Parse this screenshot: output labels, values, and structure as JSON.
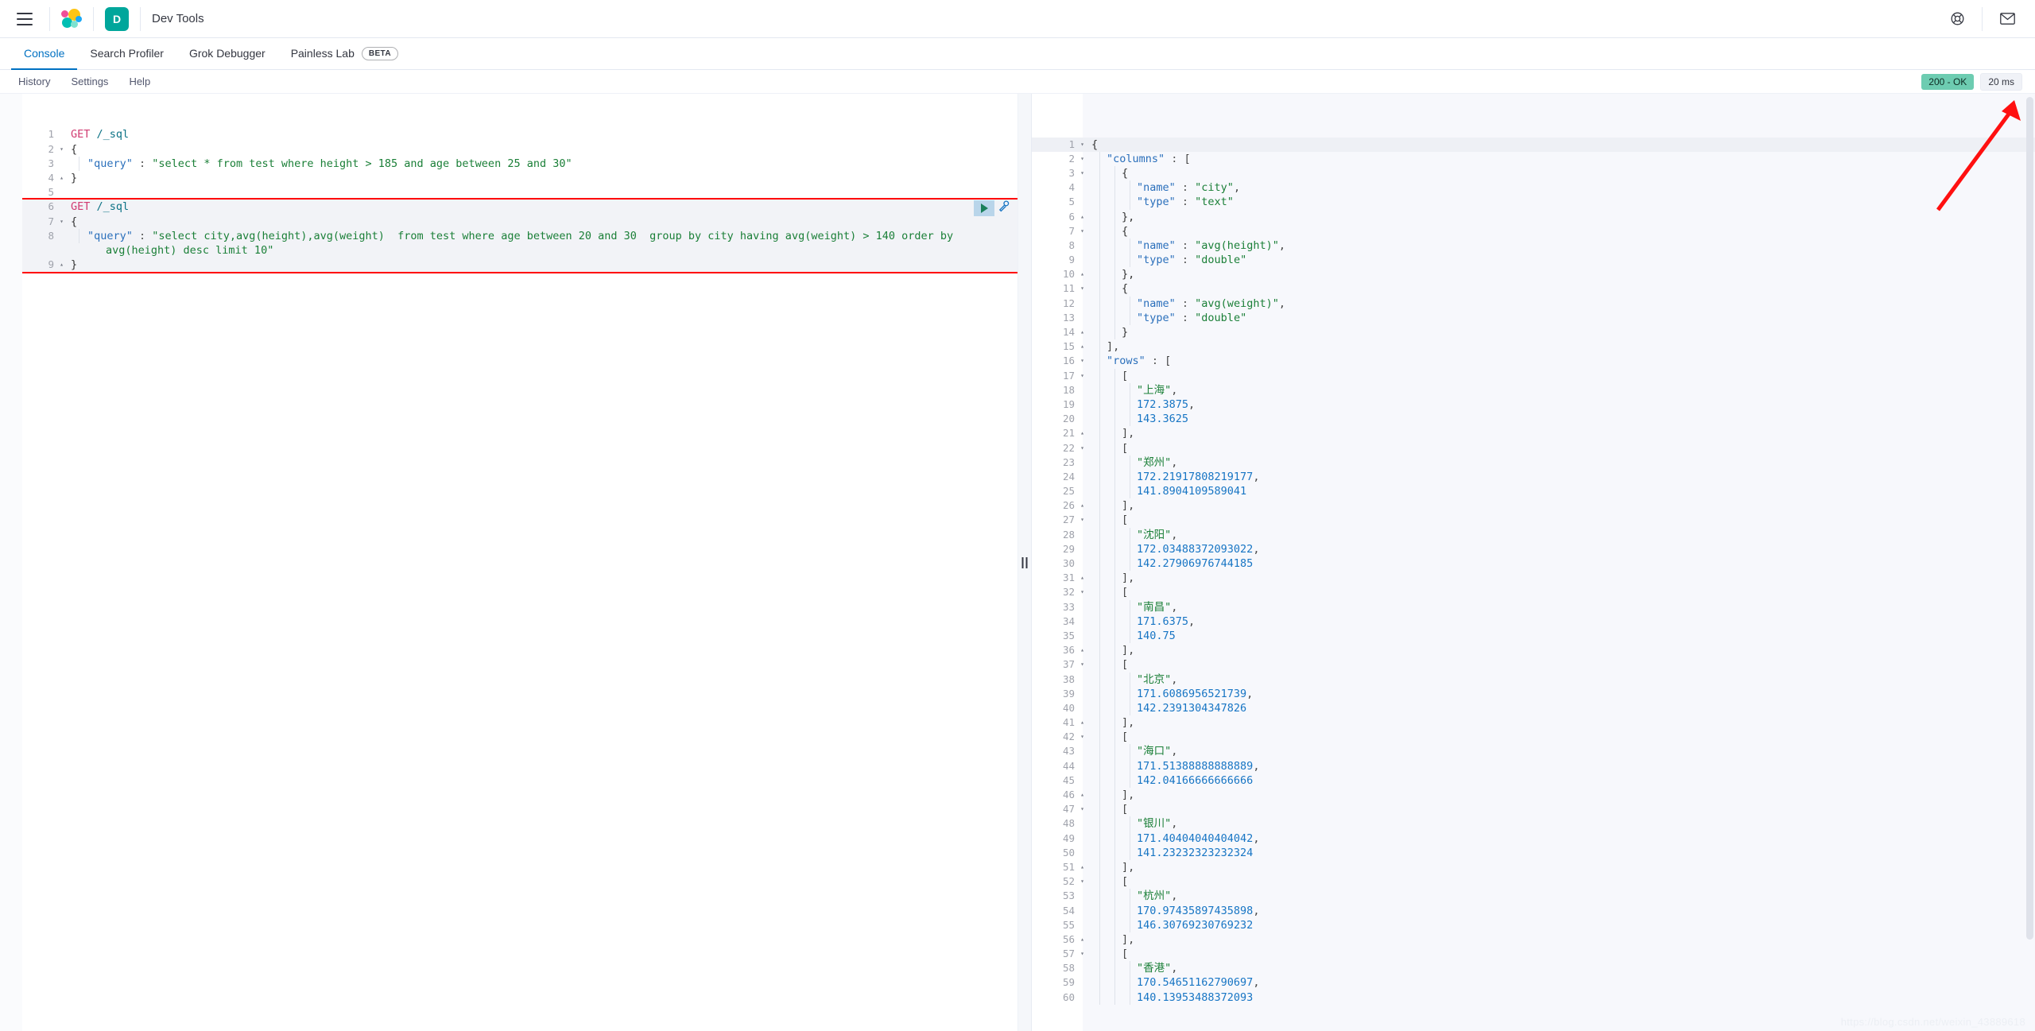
{
  "header": {
    "menu_icon": "hamburger-menu-icon",
    "brand_icon": "elastic-logo-icon",
    "space_badge": "D",
    "app_title": "Dev Tools",
    "help_icon": "lifebuoy-help-icon",
    "mail_icon": "envelope-news-icon"
  },
  "tabs": [
    {
      "label": "Console",
      "active": true,
      "badge": ""
    },
    {
      "label": "Search Profiler",
      "active": false,
      "badge": ""
    },
    {
      "label": "Grok Debugger",
      "active": false,
      "badge": ""
    },
    {
      "label": "Painless Lab",
      "active": false,
      "badge": "BETA"
    }
  ],
  "subnav": {
    "items": [
      "History",
      "Settings",
      "Help"
    ],
    "status_badge": "200 - OK",
    "time_badge": "20 ms"
  },
  "colors": {
    "accent": "#0071c2",
    "status_ok_bg": "#6dccb1",
    "space_badge_bg": "#00a69b",
    "annotation_red": "#ff0000",
    "string_green": "#1a7f37",
    "number_blue": "#1775c4",
    "method_pink": "#d13c72",
    "url_teal": "#0b7285"
  },
  "editor": {
    "requests": [
      {
        "method": "GET",
        "path": "/_sql",
        "active": false,
        "lines": [
          {
            "n": 1,
            "fold": "",
            "segs": [
              {
                "t": "method",
                "v": "GET "
              },
              {
                "t": "url",
                "v": "/_sql"
              }
            ]
          },
          {
            "n": 2,
            "fold": "down",
            "segs": [
              {
                "t": "brace",
                "v": "{"
              }
            ]
          },
          {
            "n": 3,
            "fold": "",
            "indent": 1,
            "segs": [
              {
                "t": "key",
                "v": "\"query\""
              },
              {
                "t": "colon",
                "v": " : "
              },
              {
                "t": "string",
                "v": "\"select * from test where height > 185 and age between 25 and 30\""
              }
            ]
          },
          {
            "n": 4,
            "fold": "up",
            "segs": [
              {
                "t": "brace",
                "v": "}"
              }
            ]
          },
          {
            "n": 5,
            "fold": "",
            "segs": []
          }
        ]
      },
      {
        "method": "GET",
        "path": "/_sql",
        "active": true,
        "play_icon": "play-request-icon",
        "wrench_icon": "wrench-tools-icon",
        "lines": [
          {
            "n": 6,
            "fold": "",
            "segs": [
              {
                "t": "method",
                "v": "GET "
              },
              {
                "t": "url",
                "v": "/_sql"
              }
            ]
          },
          {
            "n": 7,
            "fold": "down",
            "segs": [
              {
                "t": "brace",
                "v": "{"
              }
            ]
          },
          {
            "n": 8,
            "fold": "",
            "indent": 1,
            "wrap": true,
            "segs": [
              {
                "t": "key",
                "v": "\"query\""
              },
              {
                "t": "colon",
                "v": " : "
              },
              {
                "t": "string",
                "v": "\"select city,avg(height),avg(weight)  from test where age between 20 and 30  group by city having avg(weight) > 140 order by"
              }
            ],
            "segs2": [
              {
                "t": "string",
                "v": "avg(height) desc limit 10\""
              }
            ]
          },
          {
            "n": 9,
            "fold": "up",
            "segs": [
              {
                "t": "brace",
                "v": "}"
              }
            ]
          }
        ]
      }
    ]
  },
  "response": {
    "lines": [
      {
        "n": 1,
        "fold": "down",
        "indent": 0,
        "segs": [
          {
            "t": "brace",
            "v": "{"
          }
        ]
      },
      {
        "n": 2,
        "fold": "down",
        "indent": 0,
        "segs": [
          {
            "t": "key",
            "v": "\"columns\""
          },
          {
            "t": "colon",
            "v": " : "
          },
          {
            "t": "punct",
            "v": "["
          }
        ],
        "pad": 1
      },
      {
        "n": 3,
        "fold": "down",
        "indent": 1,
        "segs": [
          {
            "t": "brace",
            "v": "{"
          }
        ],
        "pad": 2
      },
      {
        "n": 4,
        "fold": "",
        "indent": 2,
        "segs": [
          {
            "t": "key",
            "v": "\"name\""
          },
          {
            "t": "colon",
            "v": " : "
          },
          {
            "t": "string",
            "v": "\"city\""
          },
          {
            "t": "punct",
            "v": ","
          }
        ],
        "pad": 3
      },
      {
        "n": 5,
        "fold": "",
        "indent": 2,
        "segs": [
          {
            "t": "key",
            "v": "\"type\""
          },
          {
            "t": "colon",
            "v": " : "
          },
          {
            "t": "string",
            "v": "\"text\""
          }
        ],
        "pad": 3
      },
      {
        "n": 6,
        "fold": "up",
        "indent": 1,
        "segs": [
          {
            "t": "brace",
            "v": "},"
          }
        ],
        "pad": 2
      },
      {
        "n": 7,
        "fold": "down",
        "indent": 1,
        "segs": [
          {
            "t": "brace",
            "v": "{"
          }
        ],
        "pad": 2
      },
      {
        "n": 8,
        "fold": "",
        "indent": 2,
        "segs": [
          {
            "t": "key",
            "v": "\"name\""
          },
          {
            "t": "colon",
            "v": " : "
          },
          {
            "t": "string",
            "v": "\"avg(height)\""
          },
          {
            "t": "punct",
            "v": ","
          }
        ],
        "pad": 3
      },
      {
        "n": 9,
        "fold": "",
        "indent": 2,
        "segs": [
          {
            "t": "key",
            "v": "\"type\""
          },
          {
            "t": "colon",
            "v": " : "
          },
          {
            "t": "string",
            "v": "\"double\""
          }
        ],
        "pad": 3
      },
      {
        "n": 10,
        "fold": "up",
        "indent": 1,
        "segs": [
          {
            "t": "brace",
            "v": "},"
          }
        ],
        "pad": 2
      },
      {
        "n": 11,
        "fold": "down",
        "indent": 1,
        "segs": [
          {
            "t": "brace",
            "v": "{"
          }
        ],
        "pad": 2
      },
      {
        "n": 12,
        "fold": "",
        "indent": 2,
        "segs": [
          {
            "t": "key",
            "v": "\"name\""
          },
          {
            "t": "colon",
            "v": " : "
          },
          {
            "t": "string",
            "v": "\"avg(weight)\""
          },
          {
            "t": "punct",
            "v": ","
          }
        ],
        "pad": 3
      },
      {
        "n": 13,
        "fold": "",
        "indent": 2,
        "segs": [
          {
            "t": "key",
            "v": "\"type\""
          },
          {
            "t": "colon",
            "v": " : "
          },
          {
            "t": "string",
            "v": "\"double\""
          }
        ],
        "pad": 3
      },
      {
        "n": 14,
        "fold": "up",
        "indent": 1,
        "segs": [
          {
            "t": "brace",
            "v": "}"
          }
        ],
        "pad": 2
      },
      {
        "n": 15,
        "fold": "up",
        "indent": 0,
        "segs": [
          {
            "t": "punct",
            "v": "],"
          }
        ],
        "pad": 1
      },
      {
        "n": 16,
        "fold": "down",
        "indent": 0,
        "segs": [
          {
            "t": "key",
            "v": "\"rows\""
          },
          {
            "t": "colon",
            "v": " : "
          },
          {
            "t": "punct",
            "v": "["
          }
        ],
        "pad": 1
      },
      {
        "n": 17,
        "fold": "down",
        "indent": 1,
        "segs": [
          {
            "t": "punct",
            "v": "["
          }
        ],
        "pad": 2
      },
      {
        "n": 18,
        "fold": "",
        "indent": 2,
        "segs": [
          {
            "t": "string",
            "v": "\"上海\""
          },
          {
            "t": "punct",
            "v": ","
          }
        ],
        "pad": 3
      },
      {
        "n": 19,
        "fold": "",
        "indent": 2,
        "segs": [
          {
            "t": "num",
            "v": "172.3875"
          },
          {
            "t": "punct",
            "v": ","
          }
        ],
        "pad": 3
      },
      {
        "n": 20,
        "fold": "",
        "indent": 2,
        "segs": [
          {
            "t": "num",
            "v": "143.3625"
          }
        ],
        "pad": 3
      },
      {
        "n": 21,
        "fold": "up",
        "indent": 1,
        "segs": [
          {
            "t": "punct",
            "v": "],"
          }
        ],
        "pad": 2
      },
      {
        "n": 22,
        "fold": "down",
        "indent": 1,
        "segs": [
          {
            "t": "punct",
            "v": "["
          }
        ],
        "pad": 2
      },
      {
        "n": 23,
        "fold": "",
        "indent": 2,
        "segs": [
          {
            "t": "string",
            "v": "\"郑州\""
          },
          {
            "t": "punct",
            "v": ","
          }
        ],
        "pad": 3
      },
      {
        "n": 24,
        "fold": "",
        "indent": 2,
        "segs": [
          {
            "t": "num",
            "v": "172.21917808219177"
          },
          {
            "t": "punct",
            "v": ","
          }
        ],
        "pad": 3
      },
      {
        "n": 25,
        "fold": "",
        "indent": 2,
        "segs": [
          {
            "t": "num",
            "v": "141.8904109589041"
          }
        ],
        "pad": 3
      },
      {
        "n": 26,
        "fold": "up",
        "indent": 1,
        "segs": [
          {
            "t": "punct",
            "v": "],"
          }
        ],
        "pad": 2
      },
      {
        "n": 27,
        "fold": "down",
        "indent": 1,
        "segs": [
          {
            "t": "punct",
            "v": "["
          }
        ],
        "pad": 2
      },
      {
        "n": 28,
        "fold": "",
        "indent": 2,
        "segs": [
          {
            "t": "string",
            "v": "\"沈阳\""
          },
          {
            "t": "punct",
            "v": ","
          }
        ],
        "pad": 3
      },
      {
        "n": 29,
        "fold": "",
        "indent": 2,
        "segs": [
          {
            "t": "num",
            "v": "172.03488372093022"
          },
          {
            "t": "punct",
            "v": ","
          }
        ],
        "pad": 3
      },
      {
        "n": 30,
        "fold": "",
        "indent": 2,
        "segs": [
          {
            "t": "num",
            "v": "142.27906976744185"
          }
        ],
        "pad": 3
      },
      {
        "n": 31,
        "fold": "up",
        "indent": 1,
        "segs": [
          {
            "t": "punct",
            "v": "],"
          }
        ],
        "pad": 2
      },
      {
        "n": 32,
        "fold": "down",
        "indent": 1,
        "segs": [
          {
            "t": "punct",
            "v": "["
          }
        ],
        "pad": 2
      },
      {
        "n": 33,
        "fold": "",
        "indent": 2,
        "segs": [
          {
            "t": "string",
            "v": "\"南昌\""
          },
          {
            "t": "punct",
            "v": ","
          }
        ],
        "pad": 3
      },
      {
        "n": 34,
        "fold": "",
        "indent": 2,
        "segs": [
          {
            "t": "num",
            "v": "171.6375"
          },
          {
            "t": "punct",
            "v": ","
          }
        ],
        "pad": 3
      },
      {
        "n": 35,
        "fold": "",
        "indent": 2,
        "segs": [
          {
            "t": "num",
            "v": "140.75"
          }
        ],
        "pad": 3
      },
      {
        "n": 36,
        "fold": "up",
        "indent": 1,
        "segs": [
          {
            "t": "punct",
            "v": "],"
          }
        ],
        "pad": 2
      },
      {
        "n": 37,
        "fold": "down",
        "indent": 1,
        "segs": [
          {
            "t": "punct",
            "v": "["
          }
        ],
        "pad": 2
      },
      {
        "n": 38,
        "fold": "",
        "indent": 2,
        "segs": [
          {
            "t": "string",
            "v": "\"北京\""
          },
          {
            "t": "punct",
            "v": ","
          }
        ],
        "pad": 3
      },
      {
        "n": 39,
        "fold": "",
        "indent": 2,
        "segs": [
          {
            "t": "num",
            "v": "171.6086956521739"
          },
          {
            "t": "punct",
            "v": ","
          }
        ],
        "pad": 3
      },
      {
        "n": 40,
        "fold": "",
        "indent": 2,
        "segs": [
          {
            "t": "num",
            "v": "142.2391304347826"
          }
        ],
        "pad": 3
      },
      {
        "n": 41,
        "fold": "up",
        "indent": 1,
        "segs": [
          {
            "t": "punct",
            "v": "],"
          }
        ],
        "pad": 2
      },
      {
        "n": 42,
        "fold": "down",
        "indent": 1,
        "segs": [
          {
            "t": "punct",
            "v": "["
          }
        ],
        "pad": 2
      },
      {
        "n": 43,
        "fold": "",
        "indent": 2,
        "segs": [
          {
            "t": "string",
            "v": "\"海口\""
          },
          {
            "t": "punct",
            "v": ","
          }
        ],
        "pad": 3
      },
      {
        "n": 44,
        "fold": "",
        "indent": 2,
        "segs": [
          {
            "t": "num",
            "v": "171.51388888888889"
          },
          {
            "t": "punct",
            "v": ","
          }
        ],
        "pad": 3
      },
      {
        "n": 45,
        "fold": "",
        "indent": 2,
        "segs": [
          {
            "t": "num",
            "v": "142.04166666666666"
          }
        ],
        "pad": 3
      },
      {
        "n": 46,
        "fold": "up",
        "indent": 1,
        "segs": [
          {
            "t": "punct",
            "v": "],"
          }
        ],
        "pad": 2
      },
      {
        "n": 47,
        "fold": "down",
        "indent": 1,
        "segs": [
          {
            "t": "punct",
            "v": "["
          }
        ],
        "pad": 2
      },
      {
        "n": 48,
        "fold": "",
        "indent": 2,
        "segs": [
          {
            "t": "string",
            "v": "\"银川\""
          },
          {
            "t": "punct",
            "v": ","
          }
        ],
        "pad": 3
      },
      {
        "n": 49,
        "fold": "",
        "indent": 2,
        "segs": [
          {
            "t": "num",
            "v": "171.40404040404042"
          },
          {
            "t": "punct",
            "v": ","
          }
        ],
        "pad": 3
      },
      {
        "n": 50,
        "fold": "",
        "indent": 2,
        "segs": [
          {
            "t": "num",
            "v": "141.23232323232324"
          }
        ],
        "pad": 3
      },
      {
        "n": 51,
        "fold": "up",
        "indent": 1,
        "segs": [
          {
            "t": "punct",
            "v": "],"
          }
        ],
        "pad": 2
      },
      {
        "n": 52,
        "fold": "down",
        "indent": 1,
        "segs": [
          {
            "t": "punct",
            "v": "["
          }
        ],
        "pad": 2
      },
      {
        "n": 53,
        "fold": "",
        "indent": 2,
        "segs": [
          {
            "t": "string",
            "v": "\"杭州\""
          },
          {
            "t": "punct",
            "v": ","
          }
        ],
        "pad": 3
      },
      {
        "n": 54,
        "fold": "",
        "indent": 2,
        "segs": [
          {
            "t": "num",
            "v": "170.97435897435898"
          },
          {
            "t": "punct",
            "v": ","
          }
        ],
        "pad": 3
      },
      {
        "n": 55,
        "fold": "",
        "indent": 2,
        "segs": [
          {
            "t": "num",
            "v": "146.30769230769232"
          }
        ],
        "pad": 3
      },
      {
        "n": 56,
        "fold": "up",
        "indent": 1,
        "segs": [
          {
            "t": "punct",
            "v": "],"
          }
        ],
        "pad": 2
      },
      {
        "n": 57,
        "fold": "down",
        "indent": 1,
        "segs": [
          {
            "t": "punct",
            "v": "["
          }
        ],
        "pad": 2
      },
      {
        "n": 58,
        "fold": "",
        "indent": 2,
        "segs": [
          {
            "t": "string",
            "v": "\"香港\""
          },
          {
            "t": "punct",
            "v": ","
          }
        ],
        "pad": 3
      },
      {
        "n": 59,
        "fold": "",
        "indent": 2,
        "segs": [
          {
            "t": "num",
            "v": "170.54651162790697"
          },
          {
            "t": "punct",
            "v": ","
          }
        ],
        "pad": 3
      },
      {
        "n": 60,
        "fold": "",
        "indent": 2,
        "segs": [
          {
            "t": "num",
            "v": "140.13953488372093"
          }
        ],
        "pad": 3
      }
    ]
  },
  "result_table": {
    "columns": [
      {
        "name": "city",
        "type": "text"
      },
      {
        "name": "avg(height)",
        "type": "double"
      },
      {
        "name": "avg(weight)",
        "type": "double"
      }
    ],
    "rows": [
      [
        "上海",
        172.3875,
        143.3625
      ],
      [
        "郑州",
        172.21917808219177,
        141.8904109589041
      ],
      [
        "沈阳",
        172.03488372093022,
        142.27906976744185
      ],
      [
        "南昌",
        171.6375,
        140.75
      ],
      [
        "北京",
        171.6086956521739,
        142.2391304347826
      ],
      [
        "海口",
        171.51388888888889,
        142.04166666666666
      ],
      [
        "银川",
        171.40404040404042,
        141.23232323232324
      ],
      [
        "杭州",
        170.97435897435898,
        146.30769230769232
      ],
      [
        "香港",
        170.54651162790697,
        140.13953488372093
      ]
    ]
  },
  "watermark": "https://blog.csdn.net/weixin_43889618"
}
